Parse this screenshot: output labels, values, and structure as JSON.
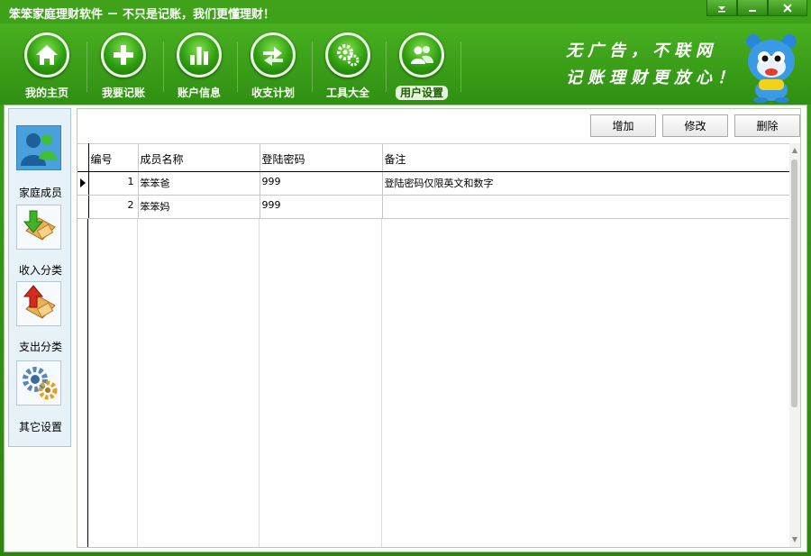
{
  "window": {
    "title": "笨笨家庭理财软件  － 不只是记账，我们更懂理财！",
    "minimize_label": "▬",
    "maximize_label": "□",
    "close_label": "✕"
  },
  "toolbar": {
    "items": [
      {
        "label": "我的主页",
        "icon": "home-icon"
      },
      {
        "label": "我要记账",
        "icon": "plus-icon"
      },
      {
        "label": "账户信息",
        "icon": "bar-chart-icon"
      },
      {
        "label": "收支计划",
        "icon": "exchange-icon"
      },
      {
        "label": "工具大全",
        "icon": "gears-icon"
      },
      {
        "label": "用户设置",
        "icon": "users-icon"
      }
    ],
    "active": "用户设置",
    "slogan_line1": "无广告，不联网",
    "slogan_line2": "记账理财更放心！"
  },
  "sidebar": {
    "items": [
      {
        "label": "家庭成员",
        "icon": "family-members-icon"
      },
      {
        "label": "收入分类",
        "icon": "income-category-icon"
      },
      {
        "label": "支出分类",
        "icon": "expense-category-icon"
      },
      {
        "label": "其它设置",
        "icon": "other-settings-icon"
      }
    ]
  },
  "actions": {
    "add_label": "增加",
    "edit_label": "修改",
    "delete_label": "删除"
  },
  "table": {
    "columns": [
      "编号",
      "成员名称",
      "登陆密码",
      "备注"
    ],
    "rows": [
      {
        "id": "1",
        "name": "笨笨爸",
        "password": "999",
        "note": "登陆密码仅限英文和数字"
      },
      {
        "id": "2",
        "name": "笨笨妈",
        "password": "999",
        "note": ""
      }
    ]
  },
  "colors": {
    "brand_green": "#2f8f12",
    "highlight_blue": "#4aa0dc"
  }
}
